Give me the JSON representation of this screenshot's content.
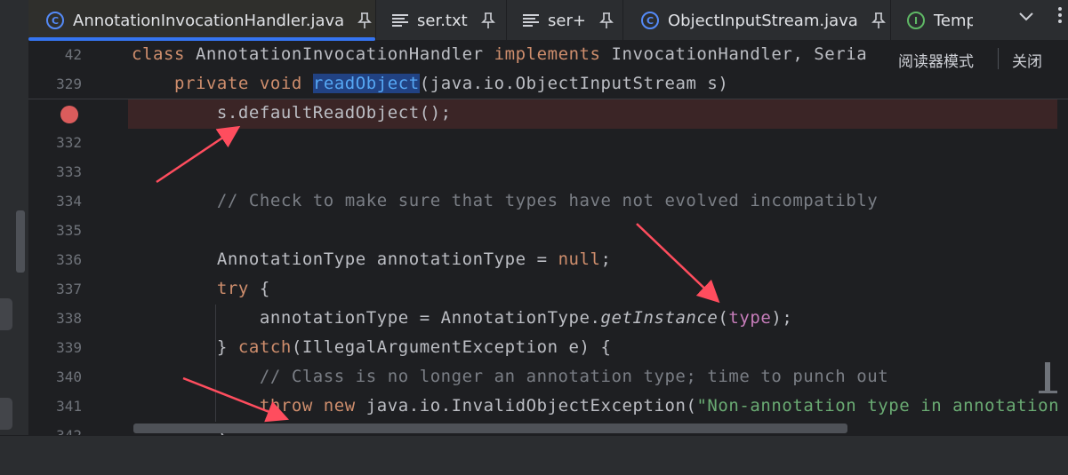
{
  "tabs": [
    {
      "label": "AnnotationInvocationHandler.java",
      "icon": "class-icon",
      "active": true
    },
    {
      "label": "ser.txt",
      "icon": "text-file-icon"
    },
    {
      "label": "ser+",
      "icon": "text-file-icon"
    },
    {
      "label": "ObjectInputStream.java",
      "icon": "class-icon"
    },
    {
      "label": "Temp",
      "icon": "interface-icon"
    }
  ],
  "reader": {
    "mode_label": "阅读器模式",
    "close_label": "关闭"
  },
  "breakpoint_color": "#db5c5c",
  "accent_color": "#3574f0",
  "lines": [
    {
      "n": "42",
      "code": "class AnnotationInvocationHandler implements InvocationHandler, Seria"
    },
    {
      "n": "329",
      "code": "    private void readObject(java.io.ObjectInputStream s)"
    },
    {
      "n": "",
      "code": "        s.defaultReadObject();",
      "breakpoint": true
    },
    {
      "n": "332",
      "code": ""
    },
    {
      "n": "333",
      "code": ""
    },
    {
      "n": "334",
      "code": "        // Check to make sure that types have not evolved incompatibly"
    },
    {
      "n": "335",
      "code": ""
    },
    {
      "n": "336",
      "code": "        AnnotationType annotationType = null;"
    },
    {
      "n": "337",
      "code": "        try {"
    },
    {
      "n": "338",
      "code": "            annotationType = AnnotationType.getInstance(type);"
    },
    {
      "n": "339",
      "code": "        } catch(IllegalArgumentException e) {"
    },
    {
      "n": "340",
      "code": "            // Class is no longer an annotation type; time to punch out"
    },
    {
      "n": "341",
      "code": "            throw new java.io.InvalidObjectException(\"Non-annotation type in annotation"
    },
    {
      "n": "342",
      "code": "        }"
    }
  ]
}
